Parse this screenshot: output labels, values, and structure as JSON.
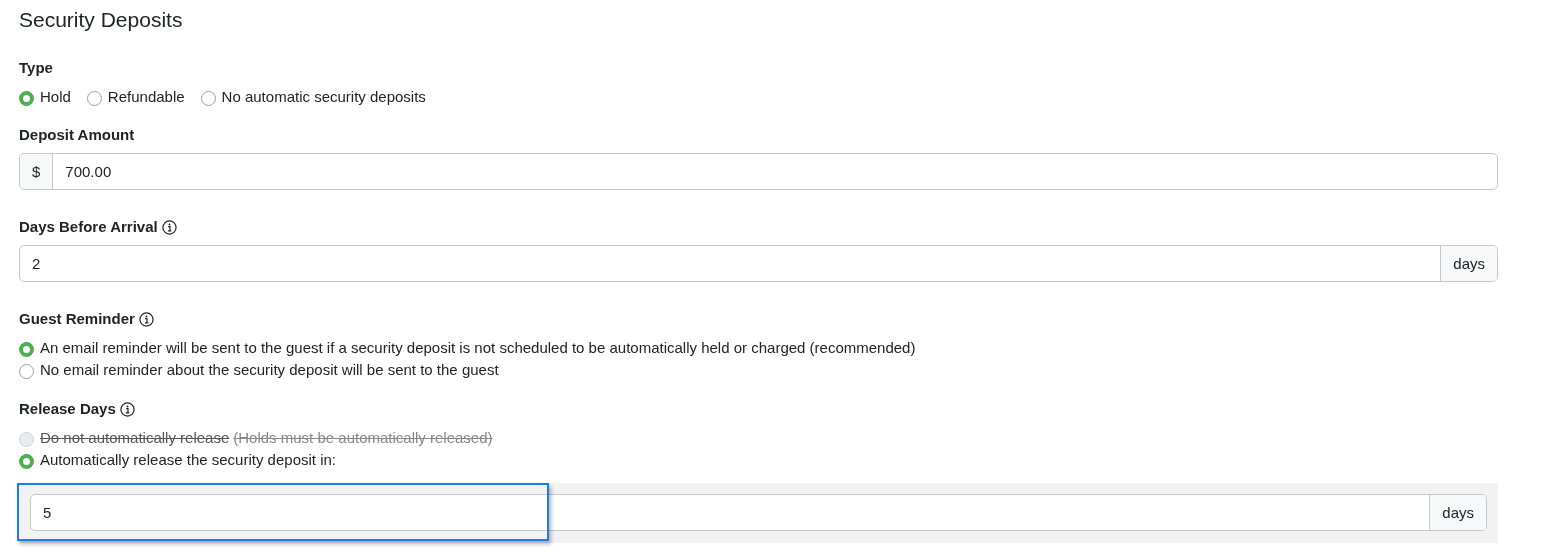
{
  "title": "Security Deposits",
  "type": {
    "label": "Type",
    "options": [
      {
        "label": "Hold",
        "selected": true
      },
      {
        "label": "Refundable",
        "selected": false
      },
      {
        "label": "No automatic security deposits",
        "selected": false
      }
    ]
  },
  "deposit_amount": {
    "label": "Deposit Amount",
    "prefix": "$",
    "value": "700.00"
  },
  "days_before_arrival": {
    "label": "Days Before Arrival",
    "value": "2",
    "suffix": "days"
  },
  "guest_reminder": {
    "label": "Guest Reminder",
    "options": [
      {
        "label": "An email reminder will be sent to the guest if a security deposit is not scheduled to be automatically held or charged (recommended)",
        "selected": true,
        "disabled": false
      },
      {
        "label": "No email reminder about the security deposit will be sent to the guest",
        "selected": false,
        "disabled": false
      }
    ]
  },
  "release_days": {
    "label": "Release Days",
    "options": [
      {
        "label": "Do not automatically release",
        "note": "(Holds must be automatically released)",
        "selected": false,
        "disabled": true
      },
      {
        "label": "Automatically release the security deposit in:",
        "selected": true,
        "disabled": false
      }
    ],
    "field": {
      "value": "5",
      "suffix": "days",
      "highlighted": true
    }
  }
}
